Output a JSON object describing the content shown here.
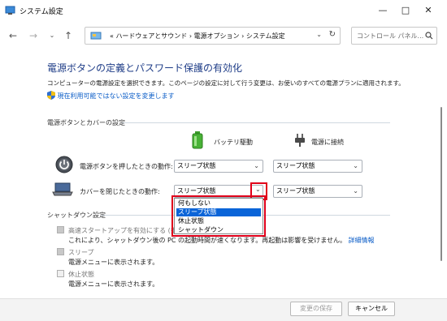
{
  "window": {
    "title": "システム設定"
  },
  "address": {
    "path": "« ハードウェアとサウンド › 電源オプション › システム設定",
    "search_placeholder": "コントロール パネル..."
  },
  "page": {
    "heading": "電源ボタンの定義とパスワード保護の有効化",
    "description": "コンピューターの電源設定を選択できます。このページの設定に対して行う変更は、お使いのすべての電源プランに適用されます。",
    "shield_link": "現在利用可能ではない設定を変更します"
  },
  "power_section": {
    "title": "電源ボタンとカバーの設定",
    "col_battery": "バッテリ駆動",
    "col_plugged": "電源に接続",
    "rows": [
      {
        "label": "電源ボタンを押したときの動作:",
        "battery": "スリープ状態",
        "plugged": "スリープ状態"
      },
      {
        "label": "カバーを閉じたときの動作:",
        "battery": "スリープ状態",
        "plugged": "スリープ状態"
      }
    ]
  },
  "dropdown": {
    "options": [
      "何もしない",
      "スリープ状態",
      "休止状態",
      "シャットダウン"
    ],
    "selected_index": 1
  },
  "shutdown_section": {
    "title": "シャットダウン設定",
    "items": [
      {
        "label": "高速スタートアップを有効にする (推奨)",
        "desc": "これにより、シャットダウン後の PC の起動時間が速くなります。再起動は影響を受けません。",
        "link": "詳細情報",
        "checked": true
      },
      {
        "label": "スリープ",
        "desc": "電源メニューに表示されます。",
        "checked": true
      },
      {
        "label": "休止状態",
        "desc": "電源メニューに表示されます。",
        "checked": false
      }
    ]
  },
  "footer": {
    "save_label": "変更の保存",
    "cancel_label": "キャンセル"
  },
  "colors": {
    "heading": "#1e3c87",
    "link": "#0a5cc7",
    "highlight": "#e0001a",
    "selected": "#0a64d8"
  }
}
